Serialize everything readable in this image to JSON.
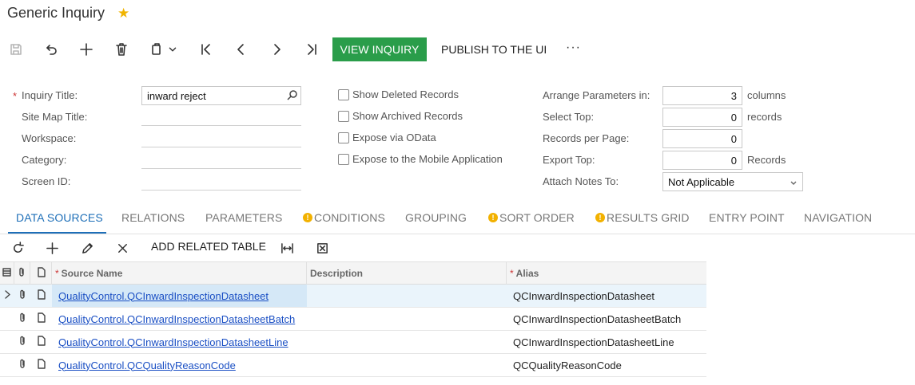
{
  "page": {
    "title": "Generic Inquiry"
  },
  "toolbar": {
    "view_inquiry_label": "VIEW INQUIRY",
    "publish_label": "PUBLISH TO THE UI",
    "more_label": "···"
  },
  "form": {
    "required_mark": "*",
    "inquiry_title_label": "Inquiry Title:",
    "inquiry_title_value": "inward reject",
    "site_map_title_label": "Site Map Title:",
    "workspace_label": "Workspace:",
    "category_label": "Category:",
    "screen_id_label": "Screen ID:",
    "show_deleted_label": "Show Deleted Records",
    "show_archived_label": "Show Archived Records",
    "expose_odata_label": "Expose via OData",
    "expose_mobile_label": "Expose to the Mobile Application",
    "arrange_params_label": "Arrange Parameters in:",
    "arrange_params_value": "3",
    "arrange_params_unit": "columns",
    "select_top_label": "Select Top:",
    "select_top_value": "0",
    "select_top_unit": "records",
    "records_per_page_label": "Records per Page:",
    "records_per_page_value": "0",
    "export_top_label": "Export Top:",
    "export_top_value": "0",
    "export_top_unit": "Records",
    "attach_notes_label": "Attach Notes To:",
    "attach_notes_value": "Not Applicable"
  },
  "tabs": [
    {
      "label": "DATA SOURCES",
      "active": true,
      "warning": false
    },
    {
      "label": "RELATIONS",
      "active": false,
      "warning": false
    },
    {
      "label": "PARAMETERS",
      "active": false,
      "warning": false
    },
    {
      "label": "CONDITIONS",
      "active": false,
      "warning": true
    },
    {
      "label": "GROUPING",
      "active": false,
      "warning": false
    },
    {
      "label": "SORT ORDER",
      "active": false,
      "warning": true
    },
    {
      "label": "RESULTS GRID",
      "active": false,
      "warning": true
    },
    {
      "label": "ENTRY POINT",
      "active": false,
      "warning": false
    },
    {
      "label": "NAVIGATION",
      "active": false,
      "warning": false
    }
  ],
  "grid_toolbar": {
    "add_related_label": "ADD RELATED TABLE"
  },
  "grid": {
    "columns": {
      "source_name": "Source Name",
      "description": "Description",
      "alias": "Alias"
    },
    "rows": [
      {
        "source_name": "QualityControl.QCInwardInspectionDatasheet",
        "description": "",
        "alias": "QCInwardInspectionDatasheet",
        "selected": true
      },
      {
        "source_name": "QualityControl.QCInwardInspectionDatasheetBatch",
        "description": "",
        "alias": "QCInwardInspectionDatasheetBatch",
        "selected": false
      },
      {
        "source_name": "QualityControl.QCInwardInspectionDatasheetLine",
        "description": "",
        "alias": "QCInwardInspectionDatasheetLine",
        "selected": false
      },
      {
        "source_name": "QualityControl.QCQualityReasonCode",
        "description": "",
        "alias": "QCQualityReasonCode",
        "selected": false
      }
    ]
  },
  "colors": {
    "accent_green": "#2a9d4a",
    "active_tab": "#1e6fb8",
    "warning": "#f2b100",
    "link": "#1a4fc4",
    "favorite_star": "#f0b400"
  }
}
